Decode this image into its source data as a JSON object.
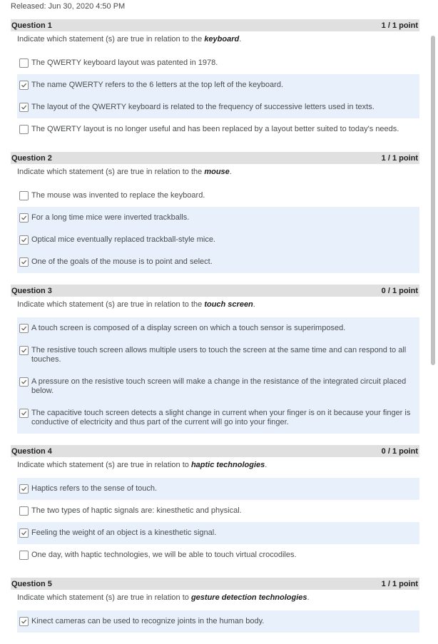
{
  "released": "Released: Jun 30, 2020 4:50 PM",
  "questions": [
    {
      "title": "Question 1",
      "score": "1 / 1 point",
      "prompt_pre": "Indicate which statement (s) are true in relation to the ",
      "prompt_em": "keyboard",
      "prompt_post": ".",
      "options": [
        {
          "text": "The QWERTY keyboard layout was patented in 1978.",
          "checked": false
        },
        {
          "text": "The name QWERTY refers to the 6 letters at the top left of the keyboard.",
          "checked": true
        },
        {
          "text": "The layout of the QWERTY keyboard is related to the frequency of successive letters used in texts.",
          "checked": true
        },
        {
          "text": "The QWERTY layout is no longer useful and has been replaced by a layout better suited to today's needs.",
          "checked": false
        }
      ]
    },
    {
      "title": "Question 2",
      "score": "1 / 1 point",
      "prompt_pre": "Indicate which statement (s) are true in relation to the ",
      "prompt_em": "mouse",
      "prompt_post": ".",
      "options": [
        {
          "text": "The mouse was invented to replace the keyboard.",
          "checked": false
        },
        {
          "text": "For a long time mice were inverted trackballs.",
          "checked": true
        },
        {
          "text": "Optical mice eventually replaced trackball-style mice.",
          "checked": true
        },
        {
          "text": "One of the goals of the mouse is to point and select.",
          "checked": true
        }
      ]
    },
    {
      "title": "Question 3",
      "score": "0 / 1 point",
      "prompt_pre": "Indicate which statement (s) are true in relation to the ",
      "prompt_em": "touch screen",
      "prompt_post": ".",
      "options": [
        {
          "text": "A touch screen is composed of a display screen on which a touch sensor is superimposed.",
          "checked": true
        },
        {
          "text": "The resistive touch screen allows multiple users to touch the screen at the same time and can respond to all touches.",
          "checked": true
        },
        {
          "text": "A pressure on the resistive touch screen will make a change in the resistance of the integrated circuit placed below.",
          "checked": true
        },
        {
          "text": "The capacitive touch screen detects a slight change in current when your finger is on it because your finger is conductive of electricity and thus part of the current will go into your finger.",
          "checked": true
        }
      ]
    },
    {
      "title": "Question 4",
      "score": "0 / 1 point",
      "prompt_pre": "Indicate which statement (s) are true in relation to ",
      "prompt_em": "haptic technologies",
      "prompt_post": ".",
      "options": [
        {
          "text": "Haptics refers to the sense of touch.",
          "checked": true
        },
        {
          "text": "The two types of haptic signals are: kinesthetic and physical.",
          "checked": false
        },
        {
          "text": "Feeling the weight of an object is a kinesthetic signal.",
          "checked": true
        },
        {
          "text": "One day, with haptic technologies, we will be able to touch virtual crocodiles.",
          "checked": false
        }
      ]
    },
    {
      "title": "Question 5",
      "score": "1 / 1 point",
      "prompt_pre": "Indicate which statement (s) are true in relation to ",
      "prompt_em": "gesture detection technologies",
      "prompt_post": ".",
      "options": [
        {
          "text": "Kinect cameras can be used to recognize joints in the human body.",
          "checked": true
        }
      ]
    }
  ],
  "icons": {
    "checkbox_check": "check-icon"
  },
  "colors": {
    "header_bg": "#e0e0e0",
    "selected_bg": "#e8f1fb"
  }
}
